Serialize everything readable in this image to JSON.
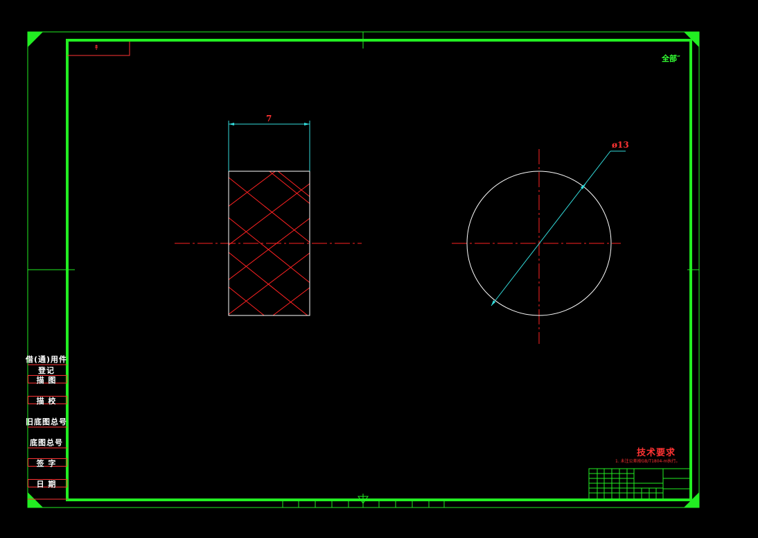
{
  "corner_tag": "↟",
  "roughness_note": "全部″",
  "dimensions": {
    "width_label": "7",
    "diameter_label": "ø13"
  },
  "tech_requirements": {
    "title": "技术要求",
    "note": "1. 未注公差按GB/T1804-m执行。"
  },
  "side_panel": [
    "借(通)用件登记",
    "描  图",
    "描  校",
    "旧底图总号",
    "底图总号",
    "签  字",
    "日  期"
  ],
  "colors": {
    "frame": "#22ee22",
    "centerline": "#ff2222",
    "outline": "#ffffff",
    "dimension": "#33dddd",
    "hatch": "#ff2222",
    "text_red": "#ff3333"
  }
}
